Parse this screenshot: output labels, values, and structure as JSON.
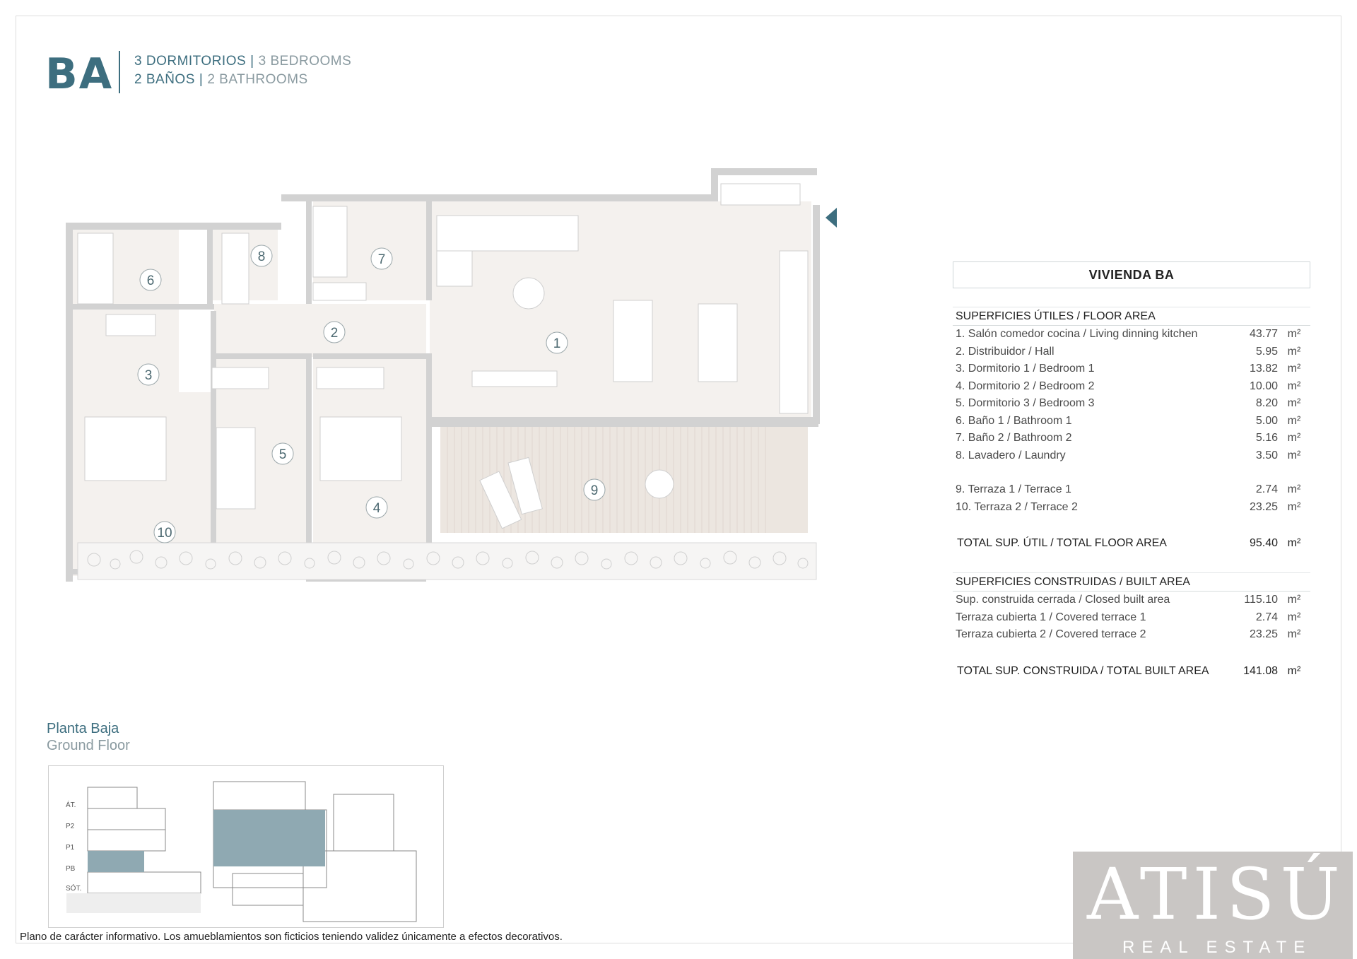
{
  "header": {
    "code": "BA",
    "bedrooms_es": "3 DORMITORIOS",
    "bedrooms_en": "3 BEDROOMS",
    "bathrooms_es": "2 BAÑOS",
    "bathrooms_en": "2 BATHROOMS",
    "separator": "|"
  },
  "plan": {
    "rooms": [
      "1",
      "2",
      "3",
      "4",
      "5",
      "6",
      "7",
      "8",
      "9",
      "10"
    ]
  },
  "table": {
    "title": "VIVIENDA BA",
    "floor_area_heading": "SUPERFICIES ÚTILES / FLOOR AREA",
    "floor_area_rows": [
      {
        "label": "1. Salón comedor cocina / Living dinning kitchen",
        "value": "43.77",
        "unit": "m²"
      },
      {
        "label": "2. Distribuidor / Hall",
        "value": "5.95",
        "unit": "m²"
      },
      {
        "label": "3. Dormitorio 1 / Bedroom 1",
        "value": "13.82",
        "unit": "m²"
      },
      {
        "label": "4. Dormitorio 2 / Bedroom 2",
        "value": "10.00",
        "unit": "m²"
      },
      {
        "label": "5. Dormitorio 3 / Bedroom 3",
        "value": "8.20",
        "unit": "m²"
      },
      {
        "label": "6. Baño 1 / Bathroom 1",
        "value": "5.00",
        "unit": "m²"
      },
      {
        "label": "7. Baño 2 / Bathroom 2",
        "value": "5.16",
        "unit": "m²"
      },
      {
        "label": "8. Lavadero / Laundry",
        "value": "3.50",
        "unit": "m²"
      }
    ],
    "terrace_rows": [
      {
        "label": "9. Terraza 1 / Terrace 1",
        "value": "2.74",
        "unit": "m²"
      },
      {
        "label": "10. Terraza 2 / Terrace 2",
        "value": "23.25",
        "unit": "m²"
      }
    ],
    "total_floor": {
      "label": "TOTAL SUP. ÚTIL / TOTAL FLOOR AREA",
      "value": "95.40",
      "unit": "m²"
    },
    "built_area_heading": "SUPERFICIES CONSTRUIDAS / BUILT AREA",
    "built_rows": [
      {
        "label": "Sup. construida cerrada / Closed built area",
        "value": "115.10",
        "unit": "m²"
      },
      {
        "label": "Terraza cubierta 1 / Covered terrace 1",
        "value": "2.74",
        "unit": "m²"
      },
      {
        "label": "Terraza cubierta 2 / Covered terrace 2",
        "value": "23.25",
        "unit": "m²"
      }
    ],
    "total_built": {
      "label": "TOTAL SUP. CONSTRUIDA /  TOTAL BUILT AREA",
      "value": "141.08",
      "unit": "m²"
    }
  },
  "floor": {
    "name_es": "Planta Baja",
    "name_en": "Ground Floor"
  },
  "key_plan": {
    "levels": [
      "ÁT.",
      "P2",
      "P1",
      "PB",
      "SÓT."
    ],
    "highlight_color": "#8fa9b2"
  },
  "disclaimer": "Plano de carácter informativo. Los amueblamientos son ficticios teniendo validez únicamente a efectos decorativos.",
  "logo": {
    "word": "ATISÚ",
    "sub": "REAL ESTATE"
  },
  "colors": {
    "brand": "#3d6e7f",
    "muted": "#8a9aa0",
    "wall": "#d2d2d2",
    "floor": "#f4f1ee"
  }
}
